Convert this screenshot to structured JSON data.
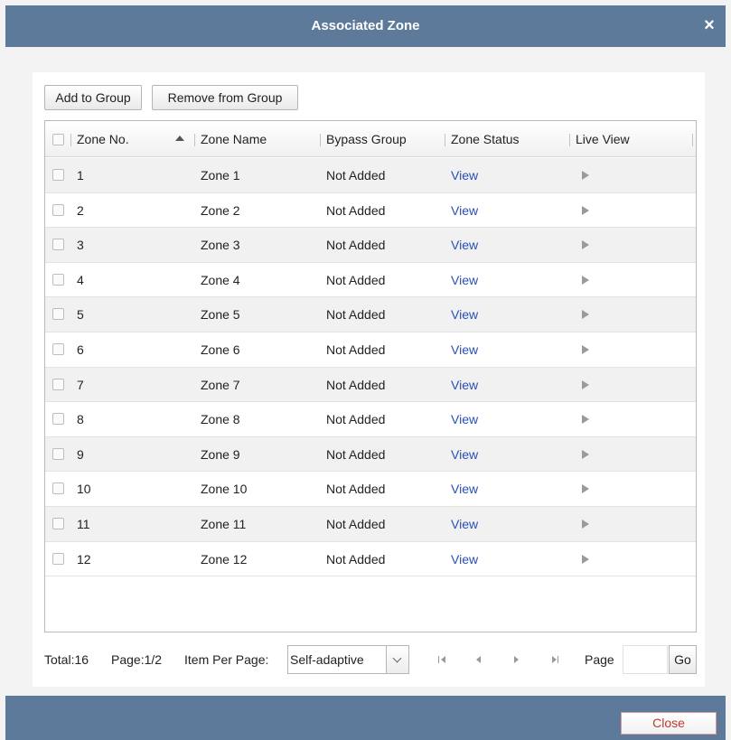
{
  "dialog": {
    "title": "Associated Zone",
    "close_icon": "×",
    "close_label": "Close"
  },
  "toolbar": {
    "add_label": "Add to Group",
    "remove_label": "Remove from Group"
  },
  "table": {
    "columns": [
      "Zone No.",
      "Zone Name",
      "Bypass Group",
      "Zone Status",
      "Live View"
    ],
    "sorted_column": "Zone No.",
    "sort_direction": "ascending",
    "rows": [
      {
        "no": "1",
        "name": "Zone 1",
        "bypass": "Not Added",
        "status": "View"
      },
      {
        "no": "2",
        "name": "Zone 2",
        "bypass": "Not Added",
        "status": "View"
      },
      {
        "no": "3",
        "name": "Zone 3",
        "bypass": "Not Added",
        "status": "View"
      },
      {
        "no": "4",
        "name": "Zone 4",
        "bypass": "Not Added",
        "status": "View"
      },
      {
        "no": "5",
        "name": "Zone 5",
        "bypass": "Not Added",
        "status": "View"
      },
      {
        "no": "6",
        "name": "Zone 6",
        "bypass": "Not Added",
        "status": "View"
      },
      {
        "no": "7",
        "name": "Zone 7",
        "bypass": "Not Added",
        "status": "View"
      },
      {
        "no": "8",
        "name": "Zone 8",
        "bypass": "Not Added",
        "status": "View"
      },
      {
        "no": "9",
        "name": "Zone 9",
        "bypass": "Not Added",
        "status": "View"
      },
      {
        "no": "10",
        "name": "Zone 10",
        "bypass": "Not Added",
        "status": "View"
      },
      {
        "no": "11",
        "name": "Zone 11",
        "bypass": "Not Added",
        "status": "View"
      },
      {
        "no": "12",
        "name": "Zone 12",
        "bypass": "Not Added",
        "status": "View"
      }
    ]
  },
  "pagination": {
    "total_text": "Total:16",
    "page_text": "Page:1/2",
    "item_per_page_label": "Item Per Page:",
    "item_per_page_value": "Self-adaptive",
    "page_label": "Page",
    "page_input_value": "",
    "go_label": "Go"
  },
  "icons": {
    "close": "close-icon",
    "sort": "sort-ascending-icon",
    "live_view": "play-icon",
    "first": "first-page-icon",
    "prev": "previous-page-icon",
    "next": "next-page-icon",
    "last": "last-page-icon",
    "dropdown": "chevron-down-icon"
  },
  "colors": {
    "title_bar": "#5e7a9b",
    "link": "#2a4fb5",
    "close_button_text": "#c0392b",
    "alt_row": "#f1f1f1"
  }
}
